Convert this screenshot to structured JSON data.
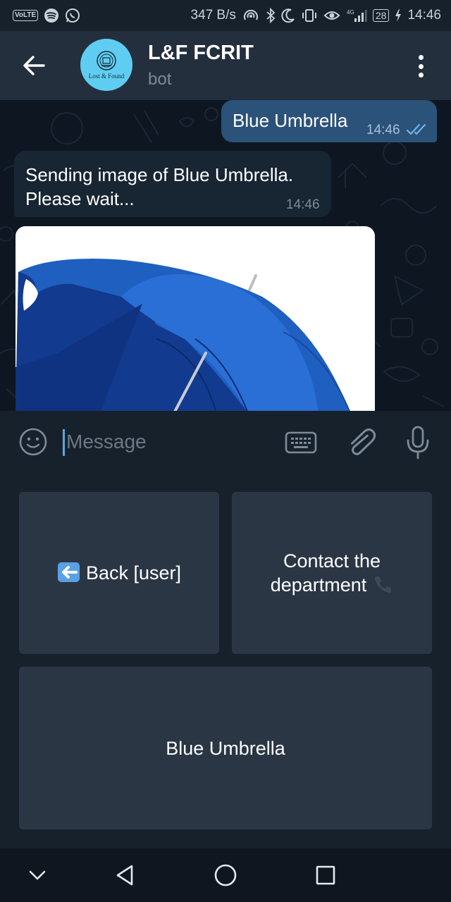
{
  "status_bar": {
    "volte": "VoLTE",
    "net_speed": "347 B/s",
    "network": "4G",
    "battery": "28",
    "time": "14:46"
  },
  "header": {
    "title": "L&F FCRIT",
    "subtitle": "bot",
    "avatar_text": "Lost & Found"
  },
  "messages": [
    {
      "direction": "outgoing",
      "text": "Blue Umbrella",
      "time": "14:46",
      "status": "read"
    },
    {
      "direction": "incoming",
      "line1": "Sending image of Blue Umbrella.",
      "line2": "Please wait...",
      "time": "14:46"
    },
    {
      "direction": "incoming",
      "type": "image",
      "content": "blue-umbrella"
    }
  ],
  "input": {
    "placeholder": "Message"
  },
  "keyboard": {
    "back": "Back [user]",
    "contact_line1": "Contact the",
    "contact_line2": "department",
    "umbrella": "Blue Umbrella"
  },
  "colors": {
    "header": "#242f3d",
    "chat_bg": "#0e1621",
    "outgoing_bubble": "#2b5278",
    "incoming_bubble": "#182533",
    "keyboard_button": "#2b3645",
    "accent": "#5ea5e0"
  },
  "icons": [
    "back-arrow-icon",
    "more-vert-icon",
    "emoji-icon",
    "keyboard-icon",
    "attach-icon",
    "mic-icon",
    "nav-collapse-icon",
    "nav-back-icon",
    "nav-home-icon",
    "nav-recents-icon"
  ]
}
